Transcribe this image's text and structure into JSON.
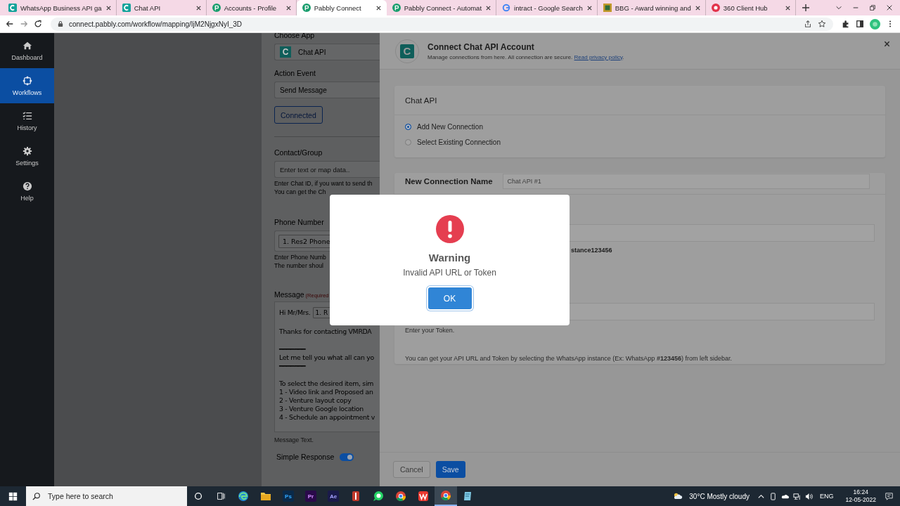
{
  "browser": {
    "tabs": [
      {
        "title": "WhatsApp Business API ga",
        "kind": "chatapi",
        "selected": false
      },
      {
        "title": "Chat API",
        "kind": "chatapi",
        "selected": false
      },
      {
        "title": "Accounts - Profile",
        "kind": "pabbly",
        "selected": false
      },
      {
        "title": "Pabbly Connect",
        "kind": "pabbly",
        "selected": true
      },
      {
        "title": "Pabbly Connect - Automat",
        "kind": "pabbly",
        "selected": false
      },
      {
        "title": "intract - Google Search",
        "kind": "google",
        "selected": false
      },
      {
        "title": "BBG - Award winning and",
        "kind": "image",
        "selected": false
      },
      {
        "title": "360 Client Hub",
        "kind": "hub",
        "selected": false
      }
    ],
    "url": "connect.pabbly.com/workflow/mapping/IjM2NjgxNyI_3D"
  },
  "sidebar": {
    "items": [
      {
        "label": "Dashboard",
        "kind": "home",
        "selected": false
      },
      {
        "label": "Workflows",
        "kind": "workflow",
        "selected": true
      },
      {
        "label": "History",
        "kind": "history",
        "selected": false
      },
      {
        "label": "Settings",
        "kind": "gear",
        "selected": false
      },
      {
        "label": "Help",
        "kind": "help",
        "selected": false
      }
    ]
  },
  "form": {
    "choose_app_label": "Choose App",
    "app": {
      "logo": "C",
      "name": "Chat API"
    },
    "action_event_label": "Action Event",
    "action_event": "Send Message",
    "connected_button": "Connected",
    "contact_label": "Contact/Group",
    "contact_placeholder": "Enter text or map data..",
    "contact_help": [
      "Enter Chat ID, if you want to send th",
      "You can get the Ch"
    ],
    "phone_label": "Phone Number",
    "phone_value": "1. Res2 Phone",
    "phone_help": [
      "Enter Phone Numb",
      "The number shoul"
    ],
    "message_label": "Message",
    "message_required": "(Required",
    "greeting": "Hi Mr/Mrs.",
    "greeting_chip": "1. R",
    "paragraphs": [
      [
        "Thanks for contacting VMRDA"
      ],
      [
        "━━━━━━━",
        "Let me tell you what all can yo",
        "━━━━━━━"
      ],
      [
        "To select the desired item, sim",
        "1 - Video link and Proposed an",
        "2 - Venture layout copy",
        "3 - Venture Google location",
        "4 - Schedule an appointment v"
      ]
    ],
    "message_hint": "Message Text.",
    "simple_response": {
      "label": "Simple Response",
      "on": true
    }
  },
  "panel": {
    "logo": "C",
    "title": "Connect Chat API Account",
    "subtitle": "Manage connections from here. All connection are secure.",
    "privacy_link": "Read privacy policy",
    "subtitle_end": ".",
    "card_title": "Chat API",
    "options": [
      {
        "label": "Add New Connection",
        "selected": true
      },
      {
        "label": "Select Existing Connection",
        "selected": false
      }
    ],
    "name_label": "New Connection Name",
    "name_value": "Chat API #1",
    "url_help": "stance123456",
    "token_help": "Enter your Token.",
    "footer_note": "You can get your API URL and Token by selecting the WhatsApp instance (Ex: WhatsApp **#123456**) from left sidebar.",
    "cancel_button": "Cancel",
    "save_button": "Save"
  },
  "dialog": {
    "title": "Warning",
    "message": "Invalid API URL or Token",
    "button": "OK"
  },
  "taskbar": {
    "search_placeholder": "Type here to search",
    "apps": [
      {
        "kind": "edge",
        "selected": false
      },
      {
        "kind": "folder",
        "selected": false
      },
      {
        "kind": "ps",
        "label": "Ps",
        "selected": false
      },
      {
        "kind": "pr",
        "label": "Pr",
        "selected": false
      },
      {
        "kind": "ae",
        "label": "Ae",
        "selected": false
      },
      {
        "kind": "tool",
        "selected": false
      },
      {
        "kind": "whatsapp",
        "selected": false
      },
      {
        "kind": "chrome",
        "selected": false
      },
      {
        "kind": "wps",
        "selected": false
      },
      {
        "kind": "chrome",
        "selected": true
      },
      {
        "kind": "notepad",
        "selected": false
      }
    ],
    "weather": "30°C Mostly cloudy",
    "language": "ENG",
    "time": "16:24",
    "date": "12-05-2022"
  }
}
